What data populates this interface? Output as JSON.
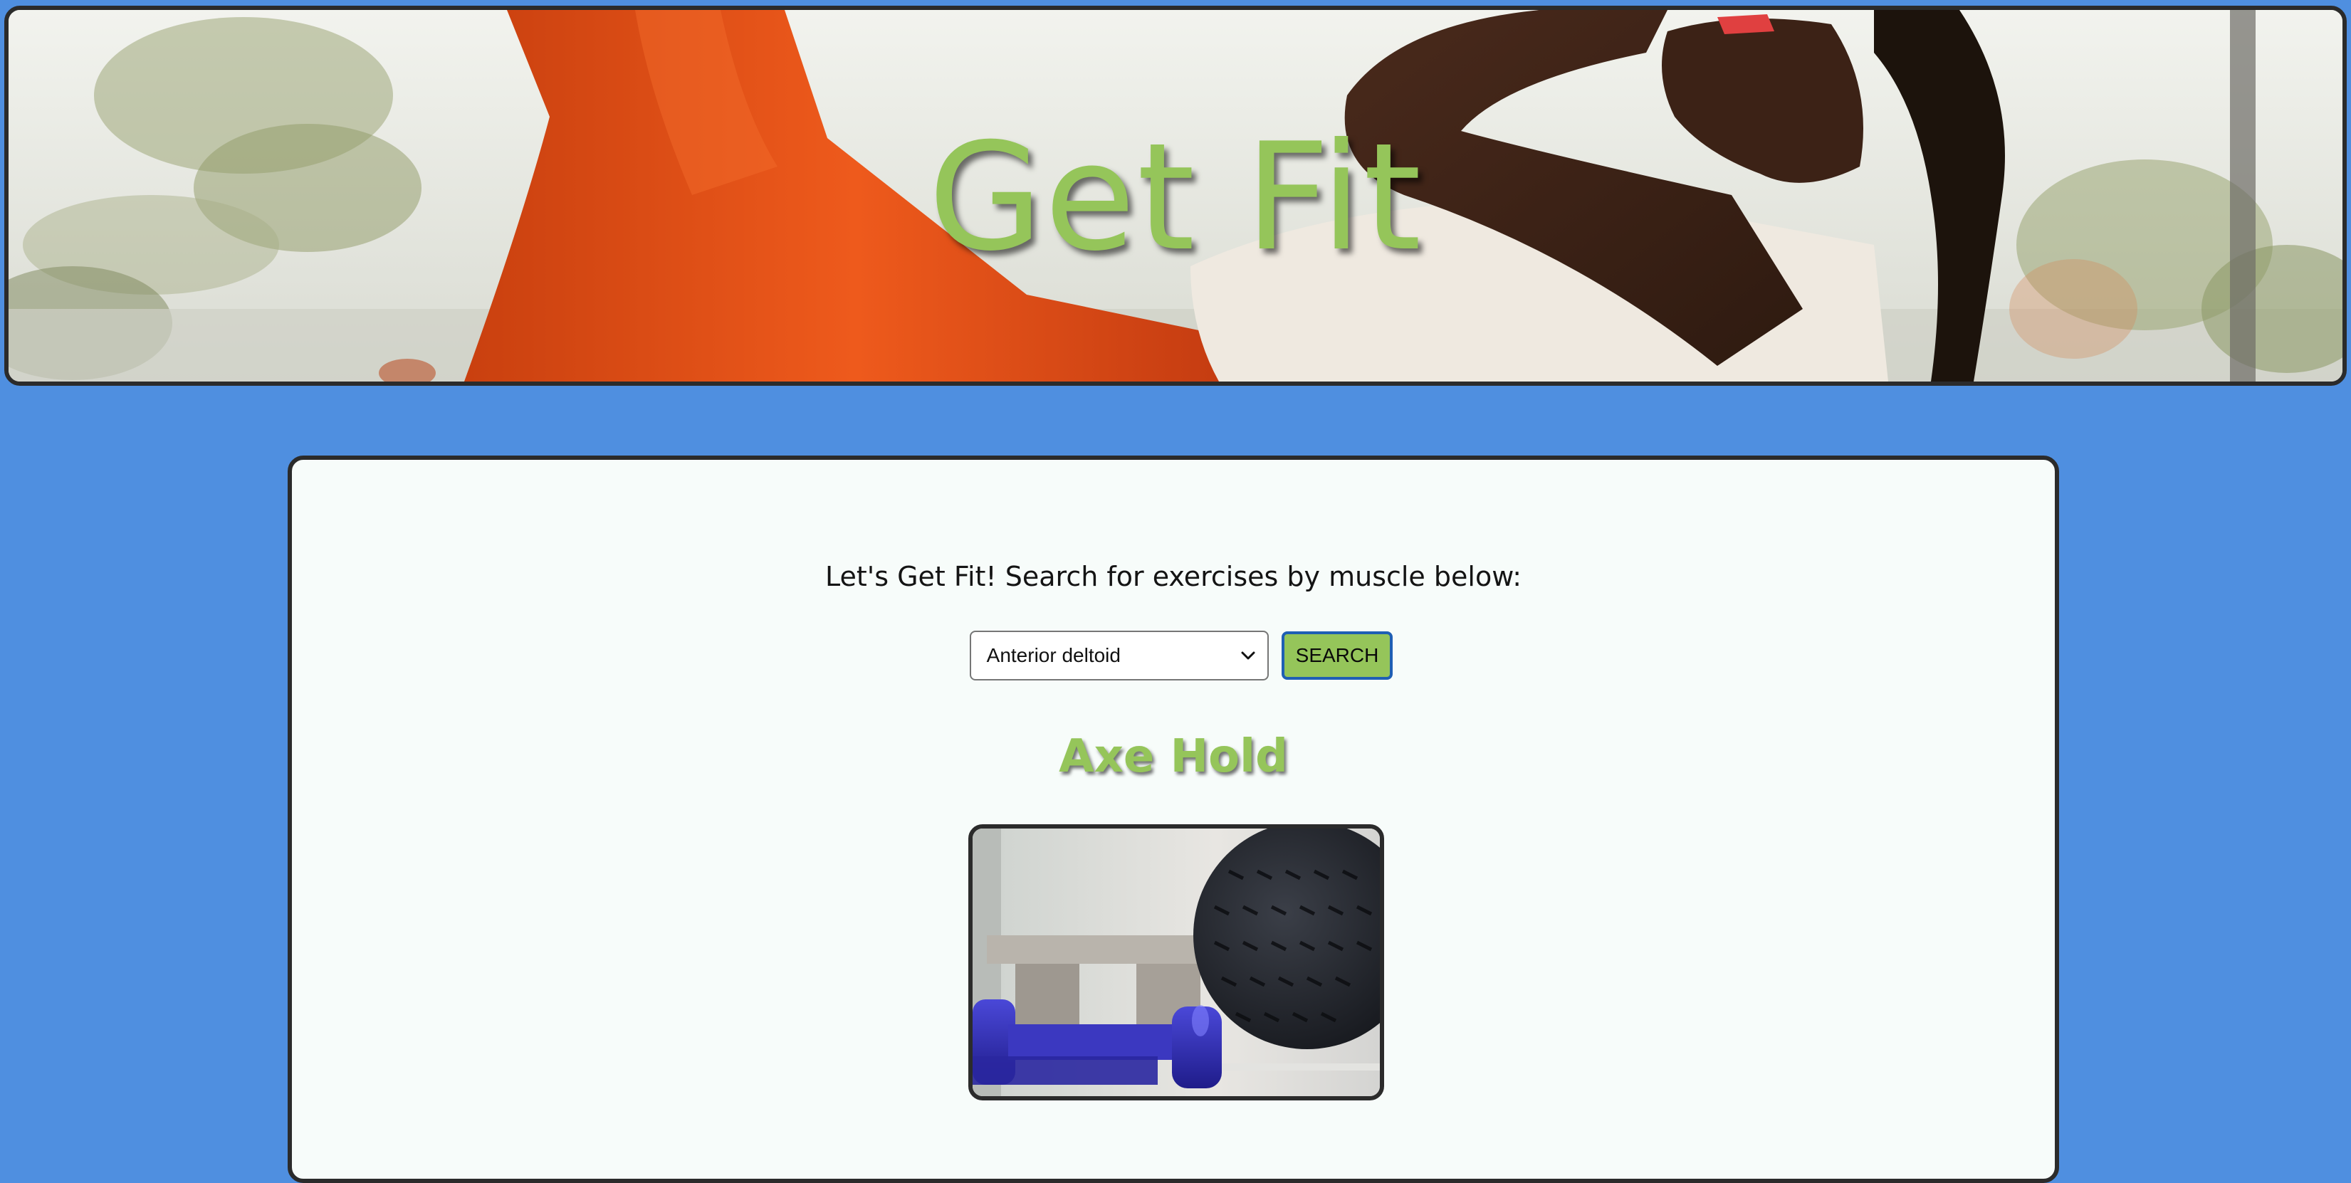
{
  "header": {
    "title": "Get Fit",
    "hero_image": "woman-doing-sit-up-photo"
  },
  "search": {
    "intro_text": "Let's Get Fit! Search for exercises by muscle below:",
    "selected_muscle": "Anterior deltoid",
    "button_label": "SEARCH"
  },
  "result": {
    "exercise_name": "Axe Hold",
    "image": "dumbbells-and-medicine-ball-photo"
  },
  "colors": {
    "page_background": "#4f8fe0",
    "accent_green": "#95c55a",
    "card_background": "#f7fcfa",
    "border": "#2b2b2b"
  }
}
